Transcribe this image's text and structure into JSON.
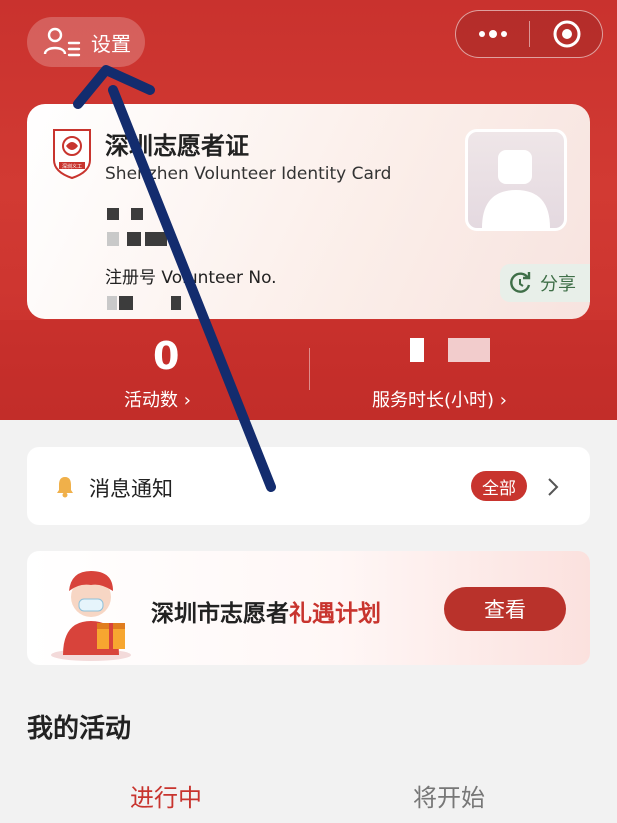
{
  "header": {
    "settings_label": "设置",
    "settings_icon": "user-settings-icon",
    "more_icon": "more-dots-icon",
    "close_icon": "target-close-icon"
  },
  "id_card": {
    "title": "深圳志愿者证",
    "subtitle": "Shenzhen Volunteer Identity Card",
    "reg_label": "注册号 Volunteer No.",
    "share_label": "分享",
    "logo_text": "深圳义工"
  },
  "stats": {
    "activity_count": "0",
    "activity_label": "活动数 ›",
    "service_label": "服务时长(小时) ›"
  },
  "notice": {
    "label": "消息通知",
    "badge": "全部"
  },
  "banner": {
    "text_prefix": "深圳市志愿者",
    "text_highlight": "礼遇计划",
    "button": "查看"
  },
  "activities": {
    "title": "我的活动",
    "tabs": [
      "进行中",
      "将开始"
    ]
  },
  "colors": {
    "brand_red": "#c8342e",
    "arrow_blue": "#132c6e"
  }
}
